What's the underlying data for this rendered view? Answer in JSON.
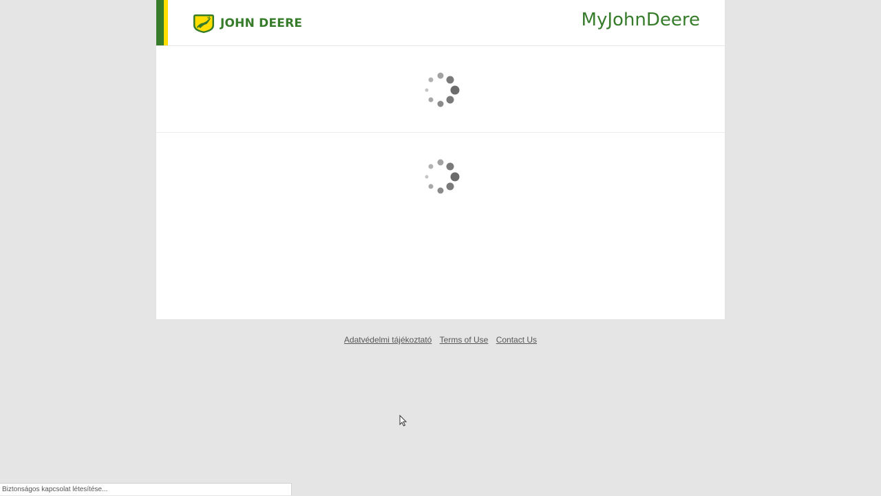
{
  "header": {
    "logo_text": "JOHN DEERE",
    "app_title": "MyJohnDeere"
  },
  "footer": {
    "links": [
      {
        "label": "Adatvédelmi tájékoztató"
      },
      {
        "label": "Terms of Use"
      },
      {
        "label": "Contact Us"
      }
    ]
  },
  "status_bar": {
    "text": "Biztonságos kapcsolat létesítése..."
  },
  "colors": {
    "brand_green": "#367c2b",
    "brand_yellow": "#ffde00",
    "background": "#e4e5e4"
  },
  "icons": {
    "logo": "deer-logo-icon",
    "spinner": "loading-spinner-icon",
    "cursor": "mouse-pointer-icon"
  }
}
